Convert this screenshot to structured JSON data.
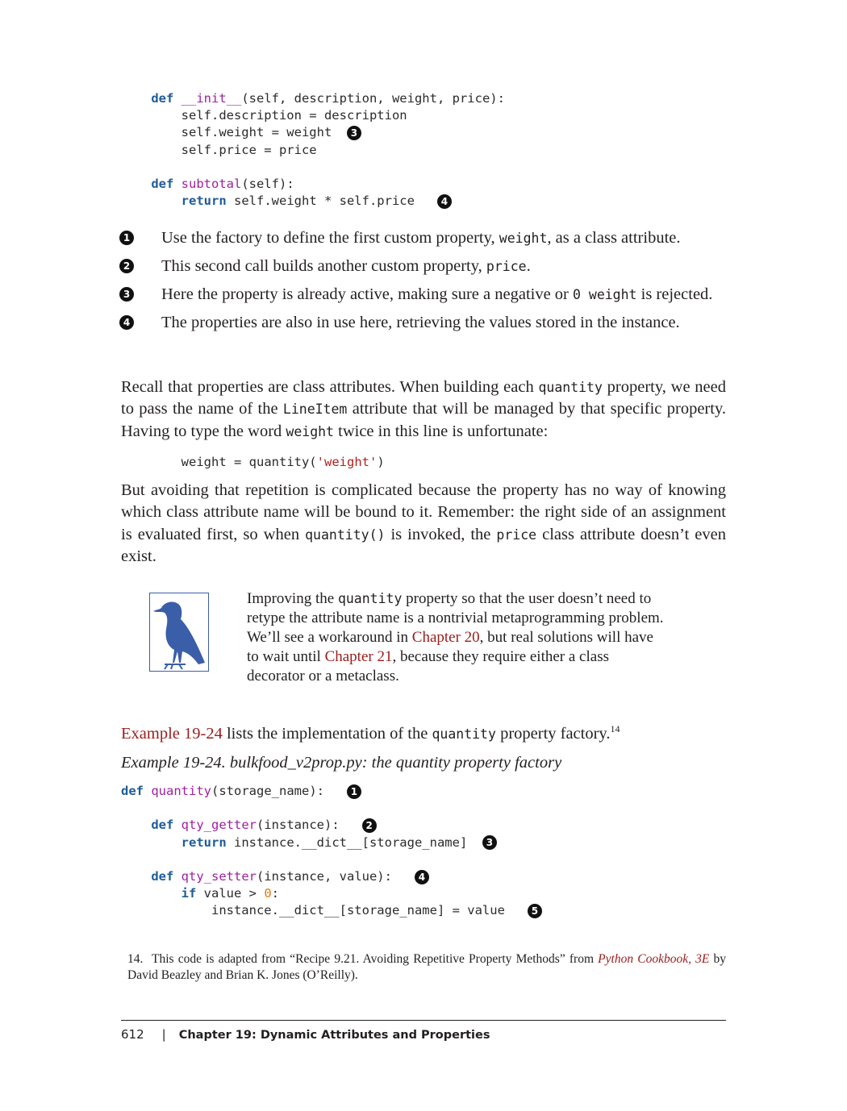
{
  "code_top": {
    "init_kw": "def",
    "init_name": "__init__",
    "init_args": "(self, description, weight, price):",
    "line_desc": "self.description = description",
    "line_weight": "self.weight = weight",
    "line_price": "self.price = price",
    "sub_kw": "def",
    "sub_name": "subtotal",
    "sub_args": "(self):",
    "return_kw": "return",
    "return_expr": "self.weight * self.price",
    "marker_3": "3",
    "marker_4": "4"
  },
  "callouts": [
    {
      "num": "1",
      "pre": "Use the factory to define the first custom property, ",
      "code": "weight",
      "post": ", as a class attribute."
    },
    {
      "num": "2",
      "pre": "This second call builds another custom property, ",
      "code": "price",
      "post": "."
    },
    {
      "num": "3",
      "pre": "Here the property is already active, making sure a negative or ",
      "code": "0 weight",
      "post": " is rejected."
    },
    {
      "num": "4",
      "pre": "The properties are also in use here, retrieving the values stored in the instance.",
      "code": "",
      "post": ""
    }
  ],
  "para1": {
    "a": "Recall that properties are class attributes. When building each ",
    "c1": "quantity",
    "b": " property, we need to pass the name of the ",
    "c2": "LineItem",
    "c": " attribute that will be managed by that specific property. Having to type the word ",
    "c3": "weight",
    "d": " twice in this line is unfortunate:"
  },
  "code_line": {
    "lhs": "weight",
    "eq": " = ",
    "fn": "quantity(",
    "str": "'weight'",
    "close": ")"
  },
  "para2": {
    "a": "But avoiding that repetition is complicated because the property has no way of knowing which class attribute name will be bound to it. Remember: the right side of an assignment is evaluated first, so when ",
    "c1": "quantity()",
    "b": " is invoked, the ",
    "c2": "price",
    "c": " class attribute doesn’t even exist."
  },
  "note": {
    "a": "Improving the ",
    "c1": "quantity",
    "b": " property so that the user doesn’t need to retype the attribute name is a nontrivial metaprogramming problem. We’ll see a workaround in ",
    "link1": "Chapter 20",
    "c": ", but real solutions will have to wait until ",
    "link2": "Chapter 21",
    "d": ", because they require either a class decorator or a metaclass."
  },
  "para3": {
    "link": "Example 19-24",
    "a": " lists the implementation of the ",
    "c1": "quantity",
    "b": " property factory.",
    "sup": "14"
  },
  "caption": "Example 19-24. bulkfood_v2prop.py: the quantity property factory",
  "code_bottom": {
    "def_kw": "def",
    "factory_name": "quantity",
    "factory_args": "(storage_name):",
    "getter_name": "qty_getter",
    "getter_args": "(instance):",
    "getter_return_kw": "return",
    "getter_return_expr": "instance.__dict__[storage_name]",
    "setter_name": "qty_setter",
    "setter_args": "(instance, value):",
    "if_kw": "if",
    "if_expr_a": "value > ",
    "if_num": "0",
    "if_colon": ":",
    "assign": "instance.__dict__[storage_name] = value",
    "m1": "1",
    "m2": "2",
    "m3": "3",
    "m4": "4",
    "m5": "5"
  },
  "footnote": {
    "num": "14.",
    "a": "This code is adapted from “Recipe 9.21. Avoiding Repetitive Property Methods” from ",
    "link": "Python Cookbook, 3E",
    "b": " by David Beazley and Brian K. Jones (O’Reilly)."
  },
  "footer": {
    "page": "612",
    "sep": "|",
    "chapter": "Chapter 19: Dynamic Attributes and Properties"
  },
  "colors": {
    "keyword": "#1f5c99",
    "function": "#a020a0",
    "string": "#b22222",
    "number": "#e07a10",
    "link": "#9b1c1c",
    "icon": "#3b5ea8"
  }
}
